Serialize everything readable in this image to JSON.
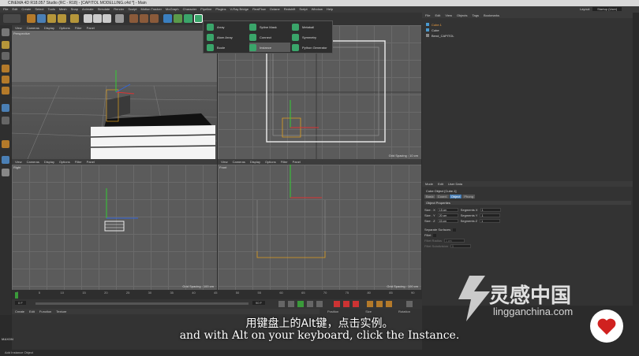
{
  "window": {
    "title": "CINEMA 4D R18.057 Studio (RC - R18) - [CAPITOL MODELLING.c4d *] - Main"
  },
  "menu": [
    "File",
    "Edit",
    "Create",
    "Select",
    "Tools",
    "Mesh",
    "Snap",
    "Animate",
    "Simulate",
    "Render",
    "Sculpt",
    "Motion Tracker",
    "MoGraph",
    "Character",
    "Pipeline",
    "Plugins",
    "V-Ray Bridge",
    "RealFlow",
    "Octane",
    "Redshift",
    "Script",
    "Window",
    "Help"
  ],
  "layout": {
    "label": "Layout:",
    "value": "Startup (User)"
  },
  "viewports": {
    "top_left": {
      "menu": [
        "View",
        "Cameras",
        "Display",
        "Options",
        "Filter",
        "Panel"
      ],
      "name": "Perspective"
    },
    "top_right": {
      "menu": [
        "View",
        "Cameras",
        "Display",
        "Options",
        "Filter",
        "Panel"
      ],
      "spacing": "Grid Spacing : 10 cm"
    },
    "bottom_left": {
      "menu": [
        "View",
        "Cameras",
        "Display",
        "Options",
        "Filter",
        "Panel"
      ],
      "name": "Right",
      "spacing": "Grid Spacing : 100 cm"
    },
    "bottom_right": {
      "menu": [
        "View",
        "Cameras",
        "Display",
        "Options",
        "Filter",
        "Panel"
      ],
      "name": "Front",
      "spacing": "Grid Spacing : 100 cm"
    }
  },
  "dropdown": {
    "items": [
      {
        "label": "Array"
      },
      {
        "label": "Atom Array"
      },
      {
        "label": "Boole"
      },
      {
        "label": "Spline Mask"
      },
      {
        "label": "Connect"
      },
      {
        "label": "Instance"
      },
      {
        "label": "Metaball"
      },
      {
        "label": "Symmetry"
      },
      {
        "label": "Python Generator"
      }
    ]
  },
  "objects": {
    "menu": [
      "File",
      "Edit",
      "View",
      "Objects",
      "Tags",
      "Bookmarks"
    ],
    "items": [
      {
        "name": "Cube.1"
      },
      {
        "name": "Cube"
      },
      {
        "name": "Bend_CAPITOL"
      }
    ]
  },
  "attributes": {
    "menu": [
      "Mode",
      "Edit",
      "User Data"
    ],
    "title": "Cube Object [Cube.1]",
    "tabs": [
      "Basic",
      "Coord.",
      "Object",
      "Phong"
    ],
    "section": "Object Properties",
    "rows": [
      {
        "label": "Size . X",
        "value": "15 cm",
        "seg_label": "Segments X",
        "seg": "1"
      },
      {
        "label": "Size . Y",
        "value": "20 cm",
        "seg_label": "Segments Y",
        "seg": "1"
      },
      {
        "label": "Size . Z",
        "value": "15 cm",
        "seg_label": "Segments Z",
        "seg": "1"
      }
    ],
    "separate": "Separate Surfaces",
    "fillet": "Fillet",
    "fillet_radius": "Fillet Radius",
    "fillet_sub": "Fillet Subdivision",
    "fillet_radius_value": "1 cm",
    "fillet_sub_value": "5"
  },
  "timeline": {
    "start": "0 F",
    "end": "90 F",
    "current": "0 F",
    "ticks": [
      "0",
      "5",
      "10",
      "15",
      "20",
      "25",
      "30",
      "35",
      "40",
      "45",
      "50",
      "55",
      "60",
      "65",
      "70",
      "75",
      "80",
      "85",
      "90"
    ]
  },
  "materials": {
    "menu": [
      "Create",
      "Edit",
      "Function",
      "Texture"
    ]
  },
  "coords": {
    "position": "Position",
    "size": "Size",
    "rotation": "Rotation"
  },
  "status": "Add Instance Object",
  "subtitles": {
    "cn": "用键盘上的Alt键，点击实例。",
    "en": "and with Alt on your keyboard, click the Instance."
  },
  "watermark": {
    "cn": "灵感中国",
    "en": "lingganchina.com"
  },
  "brand": "MAXON"
}
